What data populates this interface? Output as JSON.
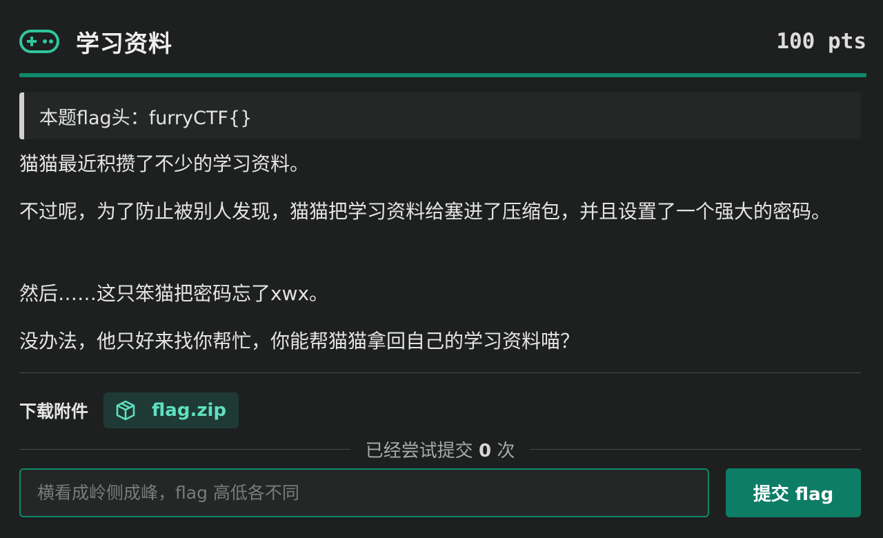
{
  "header": {
    "icon": "gamepad-icon",
    "title": "学习资料",
    "points": "100 pts"
  },
  "note": {
    "text": "本题flag头：furryCTF{}"
  },
  "description": {
    "p1": "猫猫最近积攒了不少的学习资料。",
    "p2": "不过呢，为了防止被别人发现，猫猫把学习资料给塞进了压缩包，并且设置了一个强大的密码。",
    "p3": "然后……这只笨猫把密码忘了xwx。",
    "p4": "没办法，他只好来找你帮忙，你能帮猫猫拿回自己的学习资料喵？"
  },
  "attachments": {
    "label": "下载附件",
    "file": {
      "icon": "package-icon",
      "name": "flag.zip"
    }
  },
  "attempts": {
    "prefix": "已经尝试提交",
    "count": "0",
    "suffix": "次"
  },
  "submit": {
    "placeholder": "横看成岭侧成峰，flag 高低各不同",
    "value": "",
    "button_label": "提交 flag"
  },
  "colors": {
    "accent": "#0e8a6a",
    "accent_text": "#5ee0c0",
    "background": "#1e1f1f"
  }
}
